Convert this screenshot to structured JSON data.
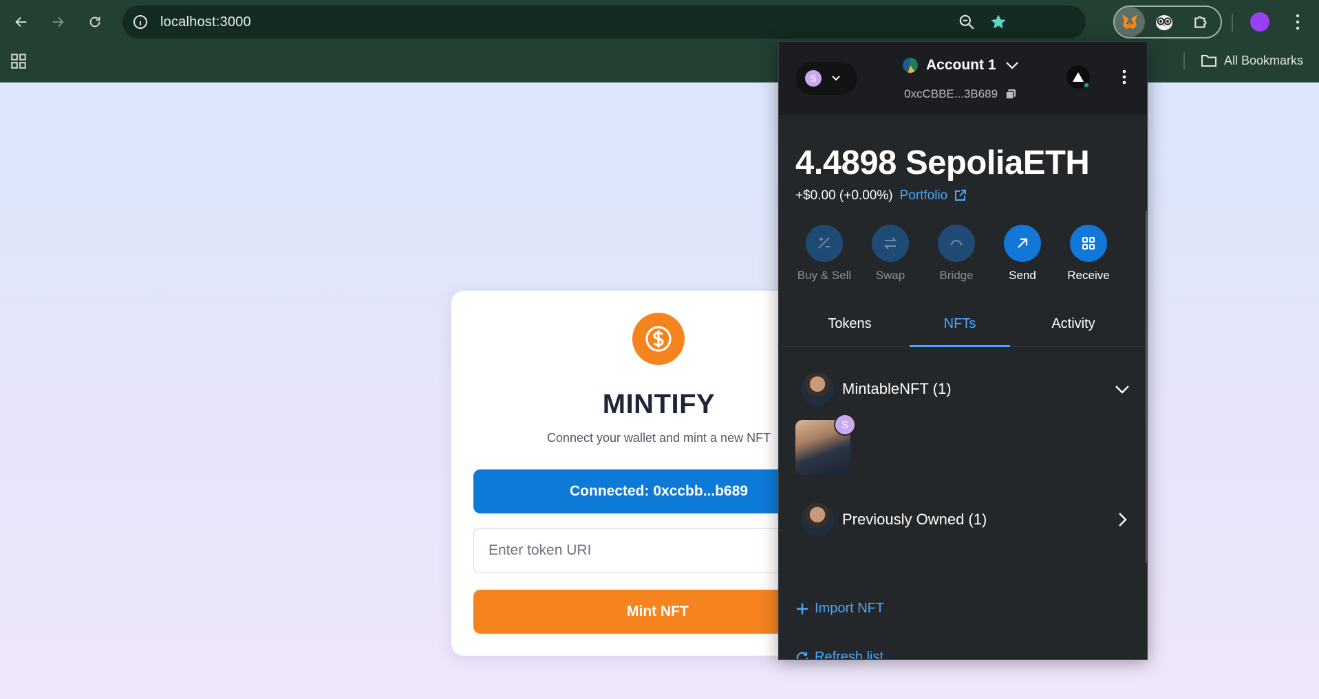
{
  "browser": {
    "url": "localhost:3000",
    "bookmarks_label": "All Bookmarks",
    "colors": {
      "chrome": "#234033",
      "star": "#5ed6c2",
      "profile": "#9b3ff5"
    }
  },
  "app": {
    "title": "MINTIFY",
    "subtitle": "Connect your wallet and mint a new NFT",
    "connected_label": "Connected: 0xccbb...b689",
    "token_uri_placeholder": "Enter token URI",
    "mint_label": "Mint NFT",
    "colors": {
      "accent": "#f5841f",
      "primary": "#0e7ad8"
    }
  },
  "wallet": {
    "network_initial": "S",
    "account_name": "Account 1",
    "account_address": "0xcCBBE...3B689",
    "balance": "4.4898 SepoliaETH",
    "change": "+$0.00 (+0.00%)",
    "portfolio_label": "Portfolio",
    "actions": [
      {
        "label": "Buy & Sell",
        "icon": "buy-sell-icon",
        "enabled": false
      },
      {
        "label": "Swap",
        "icon": "swap-icon",
        "enabled": false
      },
      {
        "label": "Bridge",
        "icon": "bridge-icon",
        "enabled": false
      },
      {
        "label": "Send",
        "icon": "send-arrow-icon",
        "enabled": true
      },
      {
        "label": "Receive",
        "icon": "qr-code-icon",
        "enabled": true
      }
    ],
    "tabs": [
      {
        "label": "Tokens",
        "active": false
      },
      {
        "label": "NFTs",
        "active": true
      },
      {
        "label": "Activity",
        "active": false
      }
    ],
    "collection_name": "MintableNFT (1)",
    "nft_badge": "S",
    "previously_owned": "Previously Owned (1)",
    "import_label": "Import NFT",
    "refresh_label": "Refresh list",
    "colors": {
      "background": "#24272a",
      "link": "#4aa7ff",
      "action": "#1177d9"
    }
  }
}
